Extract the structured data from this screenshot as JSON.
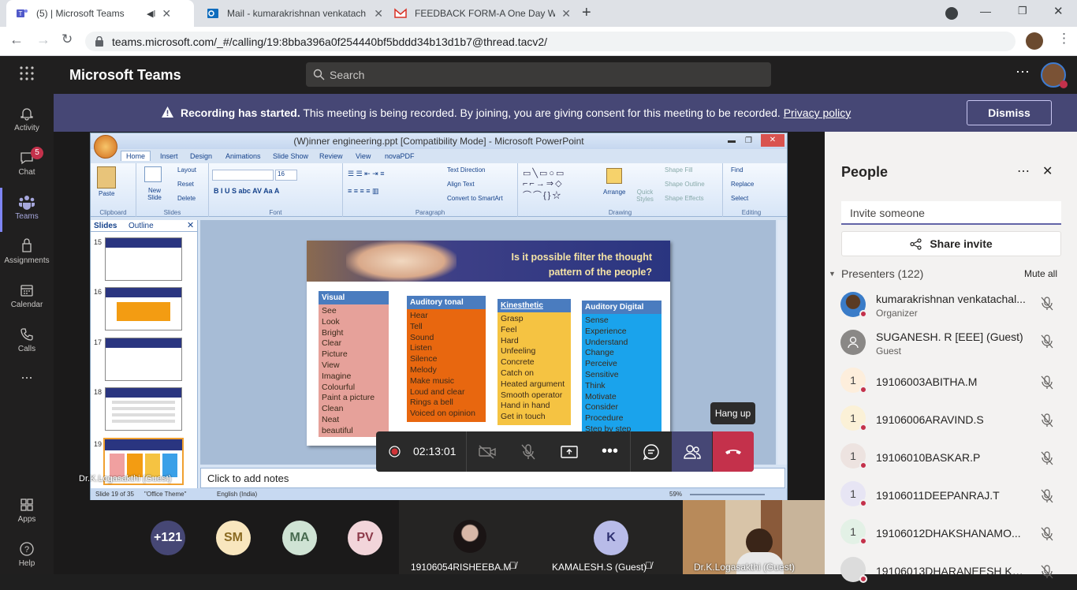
{
  "browser": {
    "tabs": [
      {
        "title": "(5) | Microsoft Teams",
        "audio": true
      },
      {
        "title": "Mail - kumarakrishnan venkatach"
      },
      {
        "title": "FEEDBACK FORM-A One Day Wo"
      }
    ],
    "url": "teams.microsoft.com/_#/calling/19:8bba396a0f254440bf5bddd34b13d1b7@thread.tacv2/"
  },
  "teams": {
    "app_name": "Microsoft Teams",
    "search_placeholder": "Search",
    "rail": [
      {
        "label": "Activity",
        "icon": "bell-icon"
      },
      {
        "label": "Chat",
        "icon": "chat-icon",
        "badge": "5"
      },
      {
        "label": "Teams",
        "icon": "teams-icon",
        "selected": true
      },
      {
        "label": "Assignments",
        "icon": "assignments-icon"
      },
      {
        "label": "Calendar",
        "icon": "calendar-icon"
      },
      {
        "label": "Calls",
        "icon": "phone-icon"
      },
      {
        "label": "...",
        "icon": "more-icon"
      },
      {
        "label": "Apps",
        "icon": "apps-icon"
      },
      {
        "label": "Help",
        "icon": "help-icon"
      }
    ],
    "banner": {
      "bold": "Recording has started.",
      "text": " This meeting is being recorded. By joining, you are giving consent for this meeting to be recorded. ",
      "link": "Privacy policy",
      "dismiss": "Dismiss"
    },
    "call": {
      "timer": "02:13:01",
      "hangup_tooltip": "Hang up"
    }
  },
  "ppt": {
    "title": "(W)inner engineering.ppt [Compatibility Mode] - Microsoft PowerPoint",
    "tabs": [
      "Home",
      "Insert",
      "Design",
      "Animations",
      "Slide Show",
      "Review",
      "View",
      "novaPDF"
    ],
    "groups": [
      "Clipboard",
      "Slides",
      "Font",
      "Paragraph",
      "Drawing",
      "Editing"
    ],
    "ribbon_labels": {
      "paste": "Paste",
      "new_slide": "New Slide",
      "layout": "Layout",
      "reset": "Reset",
      "delete": "Delete",
      "text_direction": "Text Direction",
      "align_text": "Align Text",
      "convert_smartart": "Convert to SmartArt",
      "arrange": "Arrange",
      "quick_styles": "Quick Styles",
      "shape_fill": "Shape Fill",
      "shape_outline": "Shape Outline",
      "shape_effects": "Shape Effects",
      "find": "Find",
      "replace": "Replace",
      "select": "Select",
      "font_size": "16"
    },
    "panel_tabs": [
      "Slides",
      "Outline"
    ],
    "thumb_numbers": [
      "15",
      "16",
      "17",
      "18",
      "19"
    ],
    "slide": {
      "heading": "Is it possible filter the thought pattern of the people?",
      "columns": [
        {
          "title": "Visual",
          "items": [
            "See",
            "Look",
            "Bright",
            "Clear",
            "Picture",
            "View",
            "Imagine",
            "Colourful",
            "Paint a picture",
            "Clean",
            "Neat",
            "beautiful"
          ]
        },
        {
          "title": "Auditory tonal",
          "items": [
            "Hear",
            "Tell",
            "Sound",
            "Listen",
            "Silence",
            "Melody",
            "Make music",
            "Loud and clear",
            "Rings a bell",
            "Voiced on opinion"
          ]
        },
        {
          "title": "Kinesthetic",
          "items": [
            "Grasp",
            "Feel",
            "Hard",
            "Unfeeling",
            "Concrete",
            "Catch on",
            "Heated argument",
            "Smooth operator",
            "Hand in hand",
            "Get in touch"
          ]
        },
        {
          "title": "Auditory Digital",
          "items": [
            "Sense",
            "Experience",
            "Understand",
            "Change",
            "Perceive",
            "Sensitive",
            "Think",
            "Motivate",
            "Consider",
            "Procedure",
            "Step by step"
          ]
        }
      ]
    },
    "notes_placeholder": "Click to add notes",
    "status": {
      "slide": "Slide 19 of 35",
      "theme": "\"Office Theme\"",
      "lang": "English (India)",
      "zoom": "59%"
    },
    "presenter_label": "Dr.K.Logasakthi (Guest)"
  },
  "people": {
    "title": "People",
    "invite_placeholder": "Invite someone",
    "share_invite": "Share invite",
    "presenters_label": "Presenters (122)",
    "mute_all": "Mute all",
    "list": [
      {
        "name": "kumarakrishnan venkatachal...",
        "role": "Organizer",
        "avatar": "photo"
      },
      {
        "name": "SUGANESH. R [EEE] (Guest)",
        "role": "Guest",
        "avatar": "person"
      },
      {
        "name": "19106003ABITHA.M",
        "initial": "1",
        "bg": "#fdeedc"
      },
      {
        "name": "19106006ARAVIND.S",
        "initial": "1",
        "bg": "#fbf1d7"
      },
      {
        "name": "19106010BASKAR.P",
        "initial": "1",
        "bg": "#ede3e0"
      },
      {
        "name": "19106011DEEPANRAJ.T",
        "initial": "1",
        "bg": "#e7e5f4"
      },
      {
        "name": "19106012DHAKSHANAMO...",
        "initial": "1",
        "bg": "#e3f1e6"
      },
      {
        "name": "19106013DHARANEESH KU...",
        "initial": "",
        "bg": "#dcdcdc"
      }
    ]
  },
  "gallery": {
    "avatars": [
      {
        "label": "+121",
        "bg": "#464775",
        "fg": "#ffffff"
      },
      {
        "label": "SM",
        "bg": "#f8e6be",
        "fg": "#8a6a22"
      },
      {
        "label": "MA",
        "bg": "#cfe3d4",
        "fg": "#476a4f"
      },
      {
        "label": "PV",
        "bg": "#f2d5da",
        "fg": "#8d3b4b"
      }
    ],
    "tiles": [
      {
        "name": "19106054RISHEEBA.M"
      },
      {
        "name": "KAMALESH.S (Guest)",
        "initial": "K"
      },
      {
        "name": "Dr.K.Logasakthi (Guest)"
      }
    ]
  }
}
